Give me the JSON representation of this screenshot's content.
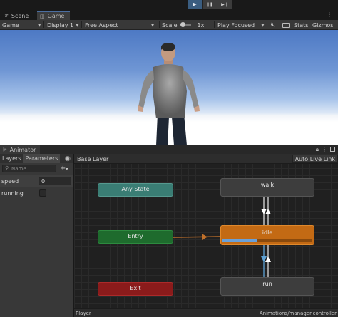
{
  "playbar": {
    "buttons": [
      {
        "icon": "play-icon",
        "glyph": "▶",
        "active": true
      },
      {
        "icon": "pause-icon",
        "glyph": "❚❚",
        "active": false
      },
      {
        "icon": "step-icon",
        "glyph": "▶❘",
        "active": false
      }
    ]
  },
  "view_tabs": [
    {
      "label": "Scene",
      "icon": "scene-grid-icon",
      "glyph": "#",
      "active": false
    },
    {
      "label": "Game",
      "icon": "game-controller-icon",
      "glyph": "◫",
      "active": true
    }
  ],
  "game_toolbar": {
    "mode": "Game",
    "display": "Display 1",
    "aspect": "Free Aspect",
    "scale_label": "Scale",
    "scale_value": "1x",
    "play_focused": "Play Focused",
    "stats": "Stats",
    "gizmos": "Gizmos"
  },
  "animator": {
    "window_title": "Animator",
    "left_tabs": [
      "Layers",
      "Parameters"
    ],
    "search_placeholder": "Name",
    "parameters": [
      {
        "name": "speed",
        "value": "0",
        "type": "float"
      },
      {
        "name": "running",
        "value": "",
        "type": "bool"
      }
    ],
    "breadcrumb": "Base Layer",
    "auto_live_link": "Auto Live Link",
    "states": {
      "any_state": "Any State",
      "entry": "Entry",
      "exit": "Exit",
      "walk": "walk",
      "idle": "idle",
      "run": "run"
    },
    "idle_progress": 0.38,
    "status_left": "Player",
    "status_right": "Animations/manager.controller"
  },
  "colors": {
    "any_state": "#3a7d74",
    "entry": "#1e6b2d",
    "exit": "#8b1b1b",
    "default_state": "#c36a14",
    "state": "#3d3d3d",
    "accent": "#4b6ea1"
  }
}
